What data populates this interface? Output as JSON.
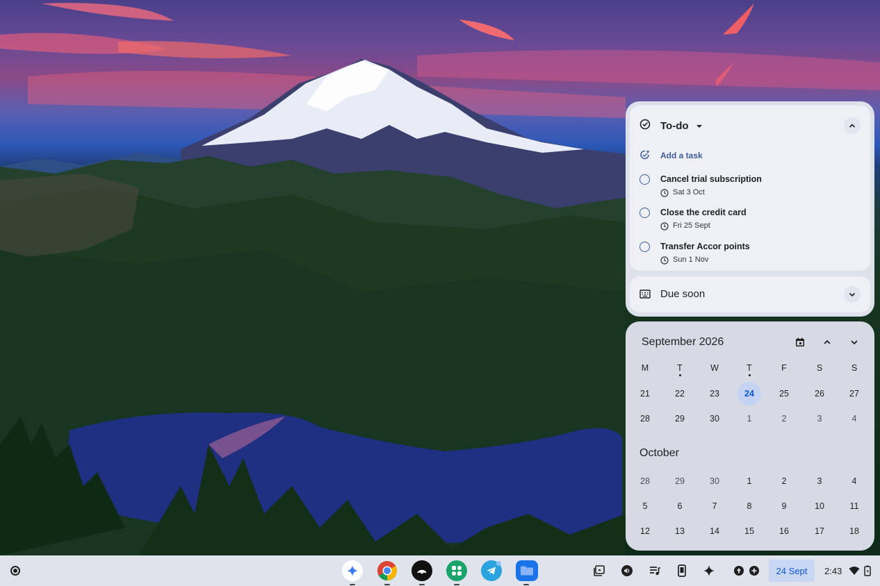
{
  "todo": {
    "title": "To-do",
    "add_task": "Add a task",
    "tasks": [
      {
        "name": "Cancel trial subscription",
        "due": "Sat 3 Oct"
      },
      {
        "name": "Close the credit card",
        "due": "Fri 25 Sept"
      },
      {
        "name": "Transfer Accor points",
        "due": "Sun 1 Nov"
      }
    ],
    "due_soon": "Due soon"
  },
  "calendar": {
    "month_title": "September 2026",
    "weekdays": [
      "M",
      "T",
      "W",
      "T",
      "F",
      "S",
      "S"
    ],
    "today": "24",
    "september_rows": [
      [
        "21",
        "22",
        "23",
        "24",
        "25",
        "26",
        "27"
      ],
      [
        "28",
        "29",
        "30",
        "1",
        "2",
        "3",
        "4"
      ]
    ],
    "next_month_label": "October",
    "october_rows": [
      [
        "28",
        "29",
        "30",
        "1",
        "2",
        "3",
        "4"
      ],
      [
        "5",
        "6",
        "7",
        "8",
        "9",
        "10",
        "11"
      ],
      [
        "12",
        "13",
        "14",
        "15",
        "16",
        "17",
        "18"
      ]
    ]
  },
  "shelf": {
    "apps": [
      "gemini-icon",
      "chrome-icon",
      "podcasts-icon",
      "app-grid-icon",
      "telegram-icon",
      "files-icon"
    ],
    "tray": [
      "screenshot-icon",
      "audio-icon",
      "media-queue-icon",
      "phone-hub-icon",
      "sparkle-icon",
      "status-icons"
    ],
    "date": "24 Sept",
    "time": "2:43"
  },
  "colors": {
    "accent": "#0b57d0",
    "today_bg": "#c4d3f3",
    "panel_bg": "#dde1ea"
  }
}
